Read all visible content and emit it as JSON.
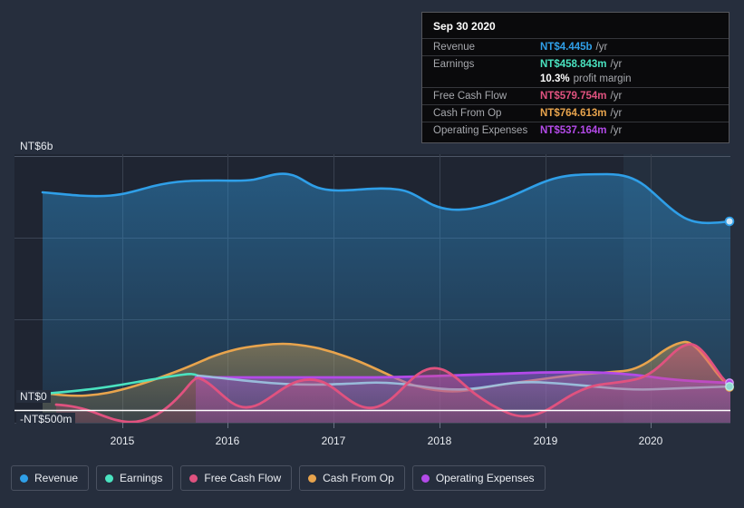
{
  "chart_data": {
    "type": "area",
    "title": "",
    "xlabel": "",
    "ylabel": "",
    "currency": "NT$",
    "grid": true,
    "legend_position": "bottom",
    "y_axis": {
      "ticks": [
        {
          "label": "NT$6b",
          "value": 6000
        },
        {
          "label": "NT$0",
          "value": 0
        },
        {
          "label": "-NT$500m",
          "value": -500
        }
      ],
      "ylim": [
        -500,
        6000
      ],
      "unit": "NT$ millions"
    },
    "x_axis": {
      "tick_labels": [
        "2015",
        "2016",
        "2017",
        "2018",
        "2019",
        "2020"
      ],
      "range": [
        "2014-06",
        "2020-12"
      ]
    },
    "series": [
      {
        "name": "Revenue",
        "color": "#2f9fe8",
        "unit": "NT$m",
        "values": [
          4520,
          4490,
          4470,
          4520,
          4690,
          4700,
          4660,
          5090,
          4820,
          4790,
          4760,
          4690,
          4480,
          4340,
          4310,
          4400,
          4440,
          4420,
          4470,
          4690,
          4890,
          5020,
          5050,
          5060,
          4980,
          4640,
          4280,
          4190,
          4200,
          4445
        ]
      },
      {
        "name": "Earnings",
        "color": "#4ae3c0",
        "unit": "NT$m",
        "values": [
          120,
          135,
          150,
          175,
          205,
          240,
          290,
          350,
          420,
          430,
          420,
          400,
          370,
          330,
          300,
          280,
          295,
          310,
          320,
          330,
          345,
          350,
          340,
          330,
          320,
          310,
          330,
          380,
          420,
          458.843
        ]
      },
      {
        "name": "Free Cash Flow",
        "color": "#e0527f",
        "unit": "NT$m",
        "values": [
          -160,
          -165,
          -170,
          -290,
          -380,
          -340,
          -150,
          430,
          150,
          60,
          180,
          310,
          290,
          120,
          160,
          390,
          430,
          400,
          200,
          -240,
          -370,
          -260,
          20,
          190,
          180,
          210,
          270,
          700,
          1050,
          579.754
        ]
      },
      {
        "name": "Cash From Op",
        "color": "#e8a44d",
        "unit": "NT$m",
        "values": [
          90,
          60,
          40,
          20,
          35,
          90,
          210,
          430,
          620,
          800,
          930,
          990,
          1000,
          960,
          880,
          770,
          640,
          490,
          310,
          140,
          90,
          180,
          330,
          400,
          430,
          510,
          640,
          1000,
          1250,
          764.613
        ]
      },
      {
        "name": "Operating Expenses",
        "color": "#b34ae8",
        "unit": "NT$m",
        "values": [
          null,
          null,
          null,
          null,
          null,
          null,
          null,
          440,
          440,
          440,
          440,
          440,
          440,
          440,
          440,
          440,
          445,
          450,
          455,
          460,
          470,
          480,
          490,
          500,
          505,
          500,
          495,
          500,
          510,
          537.164
        ]
      }
    ],
    "current_marker": {
      "date": "Sep 30 2020",
      "x_fraction": 1.0
    },
    "forecast_boundary_label": ""
  },
  "tooltip": {
    "title": "Sep 30 2020",
    "rows": [
      {
        "key": "Revenue",
        "value": "NT$4.445b",
        "suffix": "/yr",
        "color": "#2f9fe8"
      },
      {
        "key": "Earnings",
        "value": "NT$458.843m",
        "suffix": "/yr",
        "color": "#4ae3c0"
      },
      {
        "key": "",
        "value": "10.3%",
        "suffix": "profit margin",
        "color": "#ffffff"
      },
      {
        "key": "Free Cash Flow",
        "value": "NT$579.754m",
        "suffix": "/yr",
        "color": "#e0527f"
      },
      {
        "key": "Cash From Op",
        "value": "NT$764.613m",
        "suffix": "/yr",
        "color": "#e8a44d"
      },
      {
        "key": "Operating Expenses",
        "value": "NT$537.164m",
        "suffix": "/yr",
        "color": "#b34ae8"
      }
    ]
  },
  "legend": {
    "items": [
      {
        "label": "Revenue",
        "color": "#2f9fe8"
      },
      {
        "label": "Earnings",
        "color": "#4ae3c0"
      },
      {
        "label": "Free Cash Flow",
        "color": "#e0527f"
      },
      {
        "label": "Cash From Op",
        "color": "#e8a44d"
      },
      {
        "label": "Operating Expenses",
        "color": "#b34ae8"
      }
    ]
  },
  "axis": {
    "y_top": "NT$6b",
    "y_zero": "NT$0",
    "y_neg": "-NT$500m",
    "x_ticks": [
      "2015",
      "2016",
      "2017",
      "2018",
      "2019",
      "2020"
    ]
  }
}
